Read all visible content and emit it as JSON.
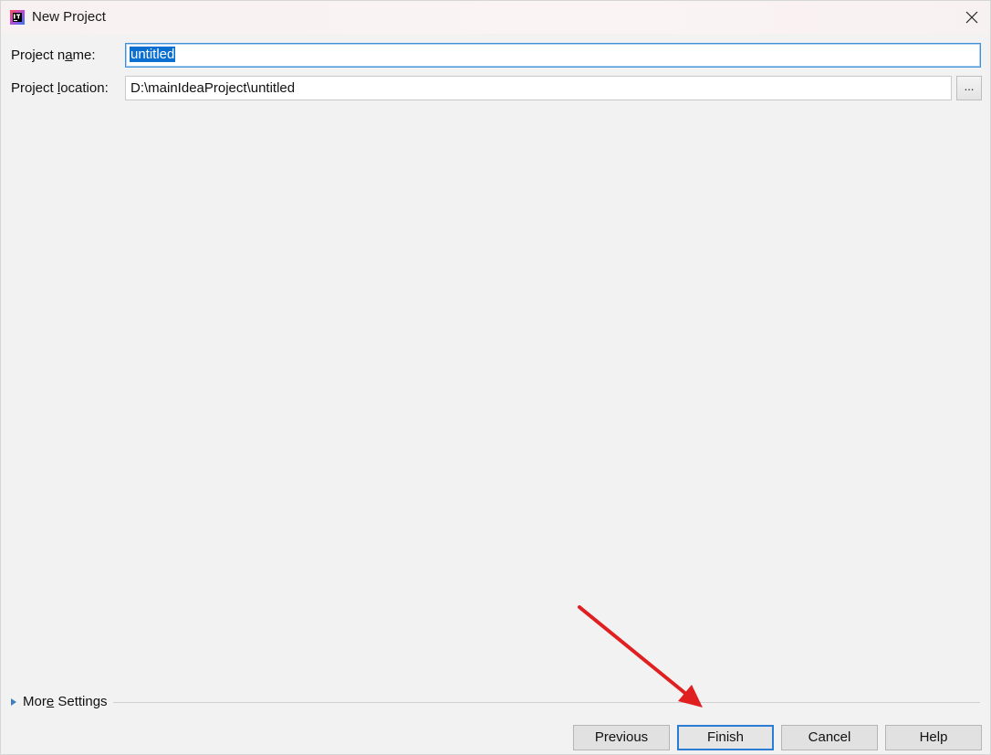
{
  "window": {
    "title": "New Project",
    "close_glyph": "✕"
  },
  "form": {
    "name_label_prefix": "Project n",
    "name_label_underlined": "a",
    "name_label_suffix": "me:",
    "name_value": "untitled",
    "location_label_prefix": "Project ",
    "location_label_underlined": "l",
    "location_label_suffix": "ocation:",
    "location_value": "D:\\mainIdeaProject\\untitled",
    "browse_label": "..."
  },
  "more_settings": {
    "label_prefix": "Mor",
    "label_underlined": "e",
    "label_suffix": " Settings"
  },
  "footer": {
    "previous_label": "Previous",
    "finish_label": "Finish",
    "cancel_label": "Cancel",
    "help_label": "Help"
  },
  "annotation": {
    "arrow_color": "#e02020"
  },
  "colors": {
    "selection": "#0a6fd0",
    "focus_border": "#2a7dd4"
  }
}
